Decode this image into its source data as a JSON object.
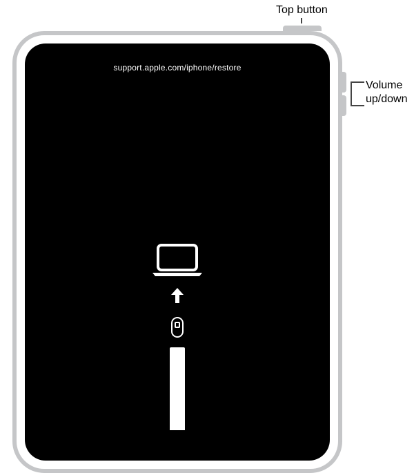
{
  "labels": {
    "top_button": "Top button",
    "volume": "Volume up/down"
  },
  "screen": {
    "restore_url": "support.apple.com/iphone/restore"
  },
  "icons": {
    "laptop": "laptop-icon",
    "arrow_up": "arrow-up-icon",
    "cable": "usb-c-cable-icon"
  }
}
